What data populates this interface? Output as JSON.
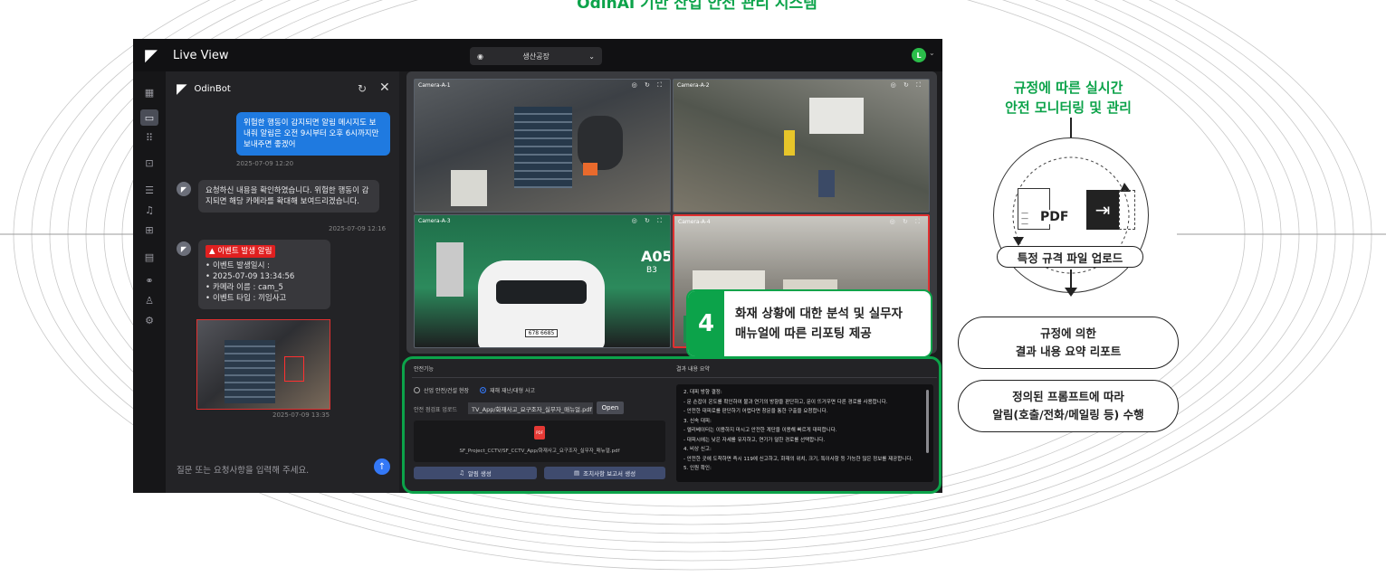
{
  "header_title": "OdinAI 기반 산업 안전 관리 시스템",
  "app": {
    "title": "Live View",
    "location": "생산공장",
    "avatar_initial": "L"
  },
  "chat": {
    "bot_name": "OdinBot",
    "user_message": "위험한 행동이 감지되면 알림 메시지도 보내줘 알림은 오전 9시부터 오후 6시까지만 보내주면 좋겠어",
    "user_time": "2025-07-09 12:20",
    "bot_reply": "요청하신 내용을 확인하였습니다. 위험한 행동이 감지되면 해당 카메라를 확대해 보여드리겠습니다.",
    "bot_reply_time": "2025-07-09 12:16",
    "alert_title": "▲ 이벤트 발생 알림",
    "alert_items": [
      "이벤트 발생일시 :",
      "2025-07-09 13:34:56",
      "카메라 이름 : cam_5",
      "이벤트 타입 : 끼임사고"
    ],
    "thumb_time": "2025-07-09 13:35",
    "input_placeholder": "질문 또는 요청사항을 입력해 주세요."
  },
  "cameras": [
    {
      "label": "Camera-A-1",
      "alert": false
    },
    {
      "label": "Camera-A-2",
      "alert": false
    },
    {
      "label": "Camera-A-3",
      "alert": false,
      "plate": "678 6685",
      "sign": "A05",
      "sign2": "B3"
    },
    {
      "label": "Camera-A-4",
      "alert": true
    }
  ],
  "callout": {
    "number": "4",
    "line1": "화재 상황에 대한 분석 및 실무자",
    "line2": "매뉴얼에 따른 리포팅 제공"
  },
  "safety": {
    "left_title": "안전기능",
    "right_title": "결과 내용 요약",
    "radio_1": "산업 안전/건설 현장",
    "radio_2": "재해 재난/대형 사고",
    "upload_label": "안전 점검표 업로드",
    "upload_path": "TV_App/화재사고_요구조자_실무자_매뉴얼.pdf",
    "open_label": "Open",
    "pdf_badge": "PDF",
    "pdf_name": "SF_Project_CCTV/SF_CCTV_App/화재사고_요구조자_실무자_매뉴얼.pdf",
    "btn_alert": "알림 생성",
    "btn_report": "조치사항 보고서 생성",
    "result": [
      "2. 대피 방향 결정:",
      "- 문 손잡이 온도를 확인하여 불과 연기의 방향을 판단하고, 문이 뜨거우면 다른 경로를 사용합니다.",
      "- 안전한 대피로를 판단하기 어렵다면 창문을 통한 구출을 요청합니다.",
      "3. 신속 대피:",
      "- 엘리베이터는 이용하지 마시고 안전한 계단을 이용해 빠르게 대피합니다.",
      "- 대피시에는 낮은 자세를 유지하고, 연기가 덜한 경로를 선택합니다.",
      "4. 비상 신고:",
      "- 안전한 곳에 도착하면 즉시 119에 신고하고, 화재의 위치, 크기, 특이사항 등 가능한 많은 정보를 제공합니다.",
      "5. 인원 확인:"
    ]
  },
  "right_panel": {
    "title_1": "규정에 따른 실시간",
    "title_2": "안전 모니터링 및 관리",
    "pdf_text": "PDF",
    "upload_pill": "특정 규격 파일 업로드",
    "box1_l1": "규정에 의한",
    "box1_l2": "결과 내용 요약 리포트",
    "box2_l1": "정의된 프롬프트에 따라",
    "box2_l2": "알림(호출/전화/메일링 등) 수행"
  },
  "colors": {
    "accent_green": "#0ca34a",
    "alert_red": "#e03030",
    "user_bubble": "#1f7ae0"
  }
}
